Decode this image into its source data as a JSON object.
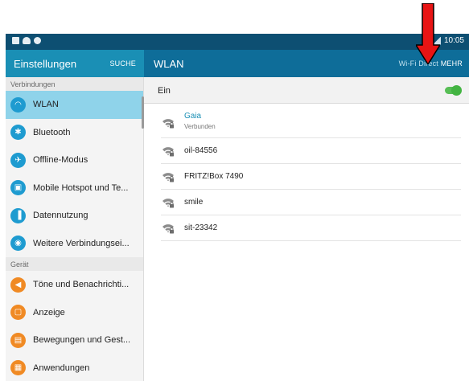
{
  "statusbar": {
    "time": "10:05"
  },
  "appbar": {
    "settings_title": "Einstellungen",
    "search_label": "SUCHE",
    "page_title": "WLAN",
    "wifi_direct_label": "Wi-Fi Direct",
    "more_label": "MEHR"
  },
  "sidebar": {
    "section_connections": "Verbindungen",
    "section_device": "Gerät",
    "connections": [
      {
        "label": "WLAN",
        "icon": "wifi-icon",
        "color": "#1e9bd0",
        "active": true
      },
      {
        "label": "Bluetooth",
        "icon": "bluetooth-icon",
        "color": "#1e9bd0",
        "active": false
      },
      {
        "label": "Offline-Modus",
        "icon": "airplane-icon",
        "color": "#1e9bd0",
        "active": false
      },
      {
        "label": "Mobile Hotspot und Te...",
        "icon": "hotspot-icon",
        "color": "#1e9bd0",
        "active": false
      },
      {
        "label": "Datennutzung",
        "icon": "data-usage-icon",
        "color": "#1e9bd0",
        "active": false
      },
      {
        "label": "Weitere Verbindungsei...",
        "icon": "more-connections-icon",
        "color": "#1e9bd0",
        "active": false
      }
    ],
    "device": [
      {
        "label": "Töne und Benachrichti...",
        "icon": "sound-icon",
        "color": "#f08a24",
        "active": false
      },
      {
        "label": "Anzeige",
        "icon": "display-icon",
        "color": "#f08a24",
        "active": false
      },
      {
        "label": "Bewegungen und Gest...",
        "icon": "motion-icon",
        "color": "#f08a24",
        "active": false
      },
      {
        "label": "Anwendungen",
        "icon": "apps-icon",
        "color": "#f08a24",
        "active": false
      }
    ]
  },
  "wlan": {
    "toggle_label": "Ein",
    "toggle_on": true,
    "networks": [
      {
        "name": "Gaia",
        "status": "Verbunden"
      },
      {
        "name": "oil-84556"
      },
      {
        "name": "FRITZ!Box 7490"
      },
      {
        "name": "smile"
      },
      {
        "name": "sit-23342"
      }
    ]
  },
  "colors": {
    "statusbar": "#0d4f72",
    "appbar_left": "#1a8fb5",
    "appbar_right": "#0e6d99",
    "active_item": "#8fd3ea",
    "toggle_on": "#57be55",
    "annotation_arrow": "#e81414"
  }
}
